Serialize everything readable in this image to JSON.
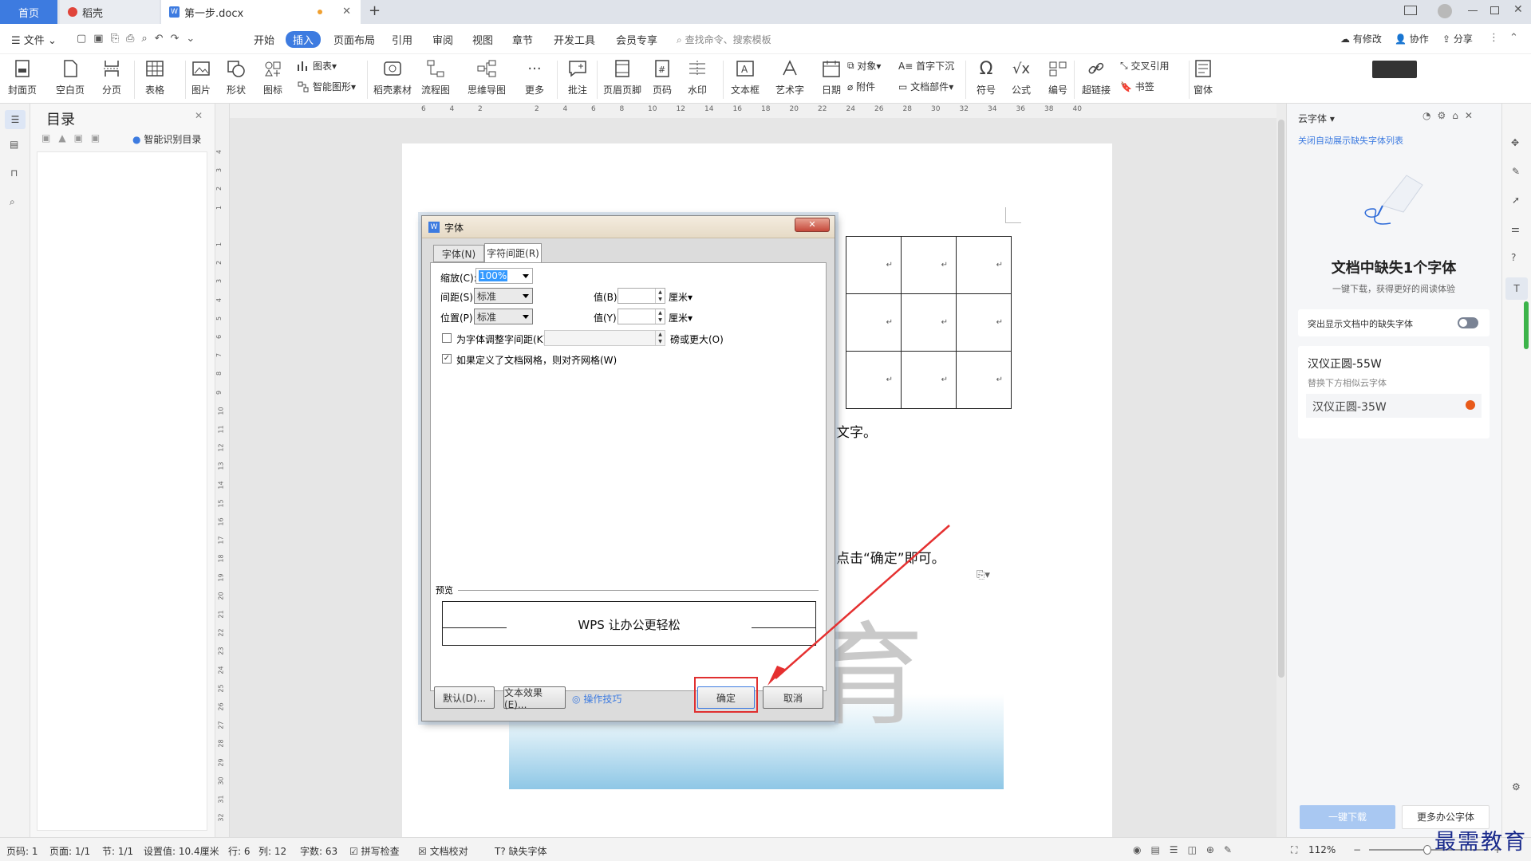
{
  "titlebar": {
    "tabs": [
      {
        "label": "首页"
      },
      {
        "label": "稻壳"
      },
      {
        "label": "第一步.docx"
      }
    ],
    "new_tab": "+"
  },
  "menubar": {
    "file": "文件",
    "items": [
      "开始",
      "插入",
      "页面布局",
      "引用",
      "审阅",
      "视图",
      "章节",
      "开发工具",
      "会员专享"
    ],
    "search": "查找命令、搜索模板",
    "right": [
      "有修改",
      "协作",
      "分享"
    ]
  },
  "ribbon": {
    "items": [
      "封面页",
      "空白页",
      "分页",
      "表格",
      "图片",
      "形状",
      "图标",
      "稻壳素材",
      "流程图",
      "思维导图",
      "更多",
      "批注",
      "页眉页脚",
      "页码",
      "水印",
      "文本框",
      "艺术字",
      "日期",
      "符号",
      "公式",
      "编号",
      "超链接",
      "窗体"
    ],
    "small": [
      "图表",
      "智能图形",
      "对象",
      "附件",
      "首字下沉",
      "文档部件",
      "交叉引用",
      "书签"
    ]
  },
  "toc": {
    "title": "目录",
    "smart": "智能识别目录"
  },
  "hruler": {
    "ticks": [
      "6",
      "4",
      "2",
      "",
      "2",
      "4",
      "6",
      "8",
      "10",
      "12",
      "14",
      "16",
      "18",
      "20",
      "22",
      "24",
      "26",
      "28",
      "30",
      "32",
      "34",
      "36",
      "38",
      "40"
    ]
  },
  "vruler": {
    "ticks": [
      "4",
      "3",
      "2",
      "1",
      "",
      "1",
      "2",
      "3",
      "4",
      "5",
      "6",
      "7",
      "8",
      "9",
      "10",
      "11",
      "12",
      "13",
      "14",
      "15",
      "16",
      "17",
      "18",
      "19",
      "20",
      "21",
      "22",
      "23",
      "24",
      "25",
      "26",
      "27",
      "28",
      "29",
      "30",
      "31",
      "32"
    ]
  },
  "document": {
    "text1": "文字。",
    "text2": "点击“确定”即可。",
    "watermark": "育",
    "table_mark": "↵"
  },
  "dialog": {
    "title": "字体",
    "close": "✕",
    "tabs": [
      "字体(N)",
      "字符间距(R)"
    ],
    "scale_label": "缩放(C):",
    "scale_value": "100%",
    "spacing_label": "间距(S):",
    "spacing_value": "标准",
    "value_b": "值(B):",
    "unit1": "厘米",
    "position_label": "位置(P):",
    "position_value": "标准",
    "value_y": "值(Y):",
    "unit2": "厘米",
    "kerning_label": "为字体调整字间距(K):",
    "kerning_suffix": "磅或更大(O)",
    "grid_label": "如果定义了文档网格，则对齐网格(W)",
    "preview_label": "预览",
    "preview_text": "WPS 让办公更轻松",
    "btn_default": "默认(D)...",
    "btn_effect": "文本效果(E)...",
    "tips": "操作技巧",
    "ok": "确定",
    "cancel": "取消"
  },
  "rpanel": {
    "title": "云字体",
    "link": "关闭自动展示缺失字体列表",
    "heading": "文档中缺失1个字体",
    "sub": "一键下载，获得更好的阅读体验",
    "toggle_label": "突出显示文档中的缺失字体",
    "font_missing": "汉仪正圆-55W",
    "replace_hint": "替换下方相似云字体",
    "font_replace": "汉仪正圆-35W",
    "download": "一键下载",
    "more": "更多办公字体"
  },
  "status": {
    "page": "页码: 1",
    "pages": "页面: 1/1",
    "section": "节: 1/1",
    "setting": "设置值: 10.4厘米",
    "row": "行: 6",
    "col": "列: 12",
    "words": "字数: 63",
    "spell": "拼写检查",
    "proof": "文档校对",
    "missing": "缺失字体",
    "zoom": "112%"
  },
  "watermark_brand": "最需教育",
  "colors": {
    "accent": "#3d7be0",
    "arrow": "#e53030",
    "highlight": "#e03030"
  }
}
